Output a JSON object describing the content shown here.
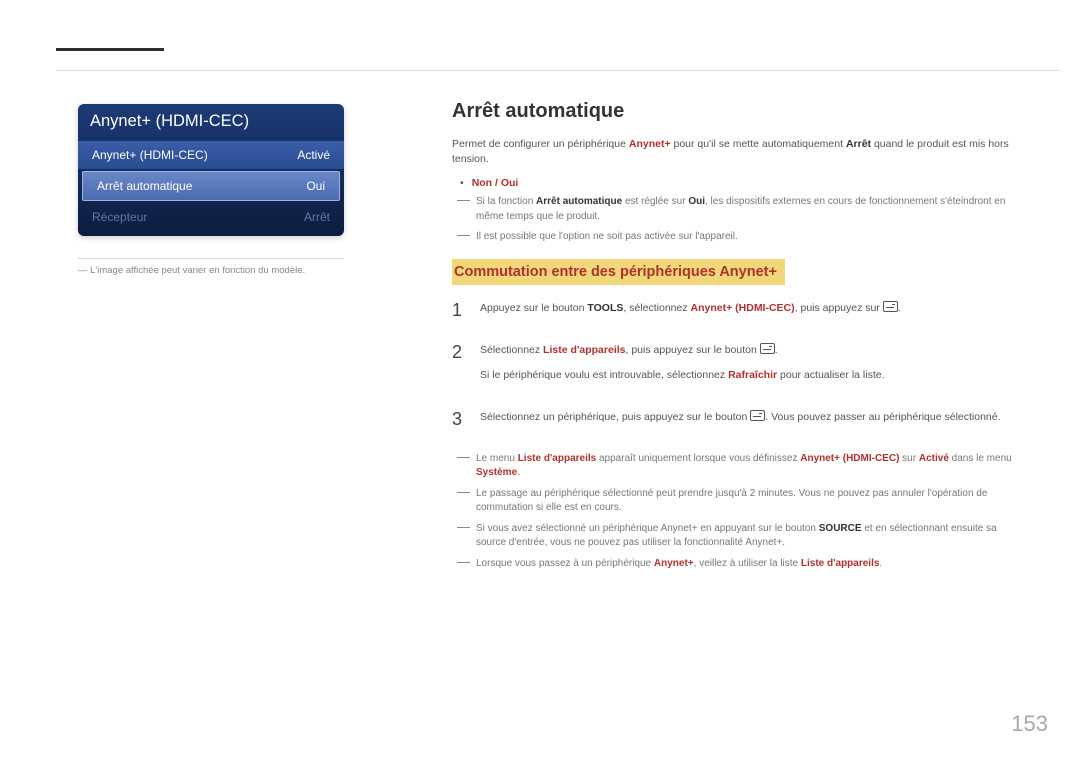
{
  "pageNumber": "153",
  "osd": {
    "title": "Anynet+ (HDMI-CEC)",
    "rows": [
      {
        "label": "Anynet+ (HDMI-CEC)",
        "value": "Activé"
      },
      {
        "label": "Arrêt automatique",
        "value": "Oui"
      },
      {
        "label": "Récepteur",
        "value": "Arrêt"
      }
    ]
  },
  "caption": "L'image affichée peut varier en fonction du modèle.",
  "section": {
    "title": "Arrêt automatique",
    "intro_pre": "Permet de configurer un périphérique ",
    "intro_red1": "Anynet+",
    "intro_mid": " pour qu'il se mette automatiquement ",
    "intro_bold1": "Arrêt",
    "intro_post": " quand le produit est mis hors tension.",
    "options": "Non / Oui",
    "note1_pre": "Si la fonction ",
    "note1_b1": "Arrêt automatique",
    "note1_mid": " est réglée sur ",
    "note1_b2": "Oui",
    "note1_post": ", les dispositifs externes en cours de fonctionnement s'éteindront en même temps que le produit.",
    "note2": "Il est possible que l'option ne soit pas activée sur l'appareil."
  },
  "subheading": "Commutation entre des périphériques Anynet+",
  "steps": {
    "s1": {
      "pre": "Appuyez sur le bouton ",
      "b1": "TOOLS",
      "mid": ", sélectionnez ",
      "r1": "Anynet+ (HDMI-CEC)",
      "post": ", puis appuyez sur "
    },
    "s2": {
      "line1_pre": "Sélectionnez ",
      "line1_r": "Liste d'appareils",
      "line1_post": ", puis appuyez sur le bouton ",
      "line2_pre": "Si le périphérique voulu est introuvable, sélectionnez ",
      "line2_r": "Rafraîchir",
      "line2_post": " pour actualiser la liste."
    },
    "s3": {
      "pre": "Sélectionnez un périphérique, puis appuyez sur le bouton ",
      "post": ". Vous pouvez passer au périphérique sélectionné."
    }
  },
  "notes": {
    "n1_pre": "Le menu ",
    "n1_r1": "Liste d'appareils",
    "n1_mid1": " apparaît uniquement lorsque vous définissez ",
    "n1_r2": "Anynet+ (HDMI-CEC)",
    "n1_mid2": " sur ",
    "n1_r3": "Activé",
    "n1_mid3": " dans le menu ",
    "n1_r4": "Système",
    "n1_post": ".",
    "n2": "Le passage au périphérique sélectionné peut prendre jusqu'à 2 minutes. Vous ne pouvez pas annuler l'opération de commutation si elle est en cours.",
    "n3_pre": "Si vous avez sélectionné un périphérique Anynet+ en appuyant sur le bouton ",
    "n3_b": "SOURCE",
    "n3_post": " et en sélectionnant ensuite sa source d'entrée, vous ne pouvez pas utiliser la fonctionnalité Anynet+.",
    "n4_pre": "Lorsque vous passez à un périphérique ",
    "n4_r1": "Anynet+",
    "n4_mid": ", veillez à utiliser la liste ",
    "n4_r2": "Liste d'appareils",
    "n4_post": "."
  }
}
